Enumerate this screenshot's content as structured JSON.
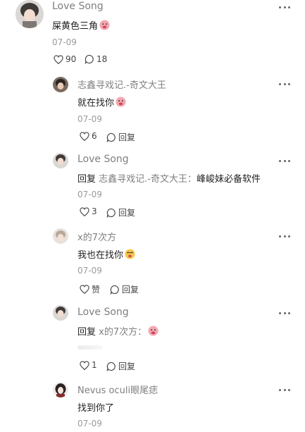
{
  "comments": [
    {
      "name": "Love Song",
      "text": "屎黄色三角",
      "date": "07-09",
      "likes": "90",
      "replies": "18"
    },
    {
      "name": "志鑫寻戏记.-奇文大王",
      "text": "就在找你",
      "date": "07-09",
      "likes": "6",
      "reply_label": "回复"
    },
    {
      "name": "Love Song",
      "prefix": "回复",
      "ref": "志鑫寻戏记.-奇文大王：",
      "text": "峰峻妹必备软件",
      "date": "07-09",
      "likes": "3",
      "reply_label": "回复"
    },
    {
      "name": "x的7次方",
      "text": "我也在找你",
      "date": "07-09",
      "likes": "赞",
      "reply_label": "回复"
    },
    {
      "name": "Love Song",
      "prefix": "回复",
      "ref": "x的7次方：",
      "text": "",
      "date": "07-09",
      "likes": "1",
      "reply_label": "回复"
    },
    {
      "name": "Nevus oculi眼尾痣",
      "text": "找到你了",
      "date": "07-09"
    }
  ],
  "colors": {
    "name": "#7f7f7f",
    "text": "#1f1f1f",
    "meta": "#9a9a9a",
    "emoji": "#f4a7b0"
  },
  "icons": [
    "heart-icon",
    "comment-icon",
    "more-icon",
    "emoji-icon"
  ]
}
